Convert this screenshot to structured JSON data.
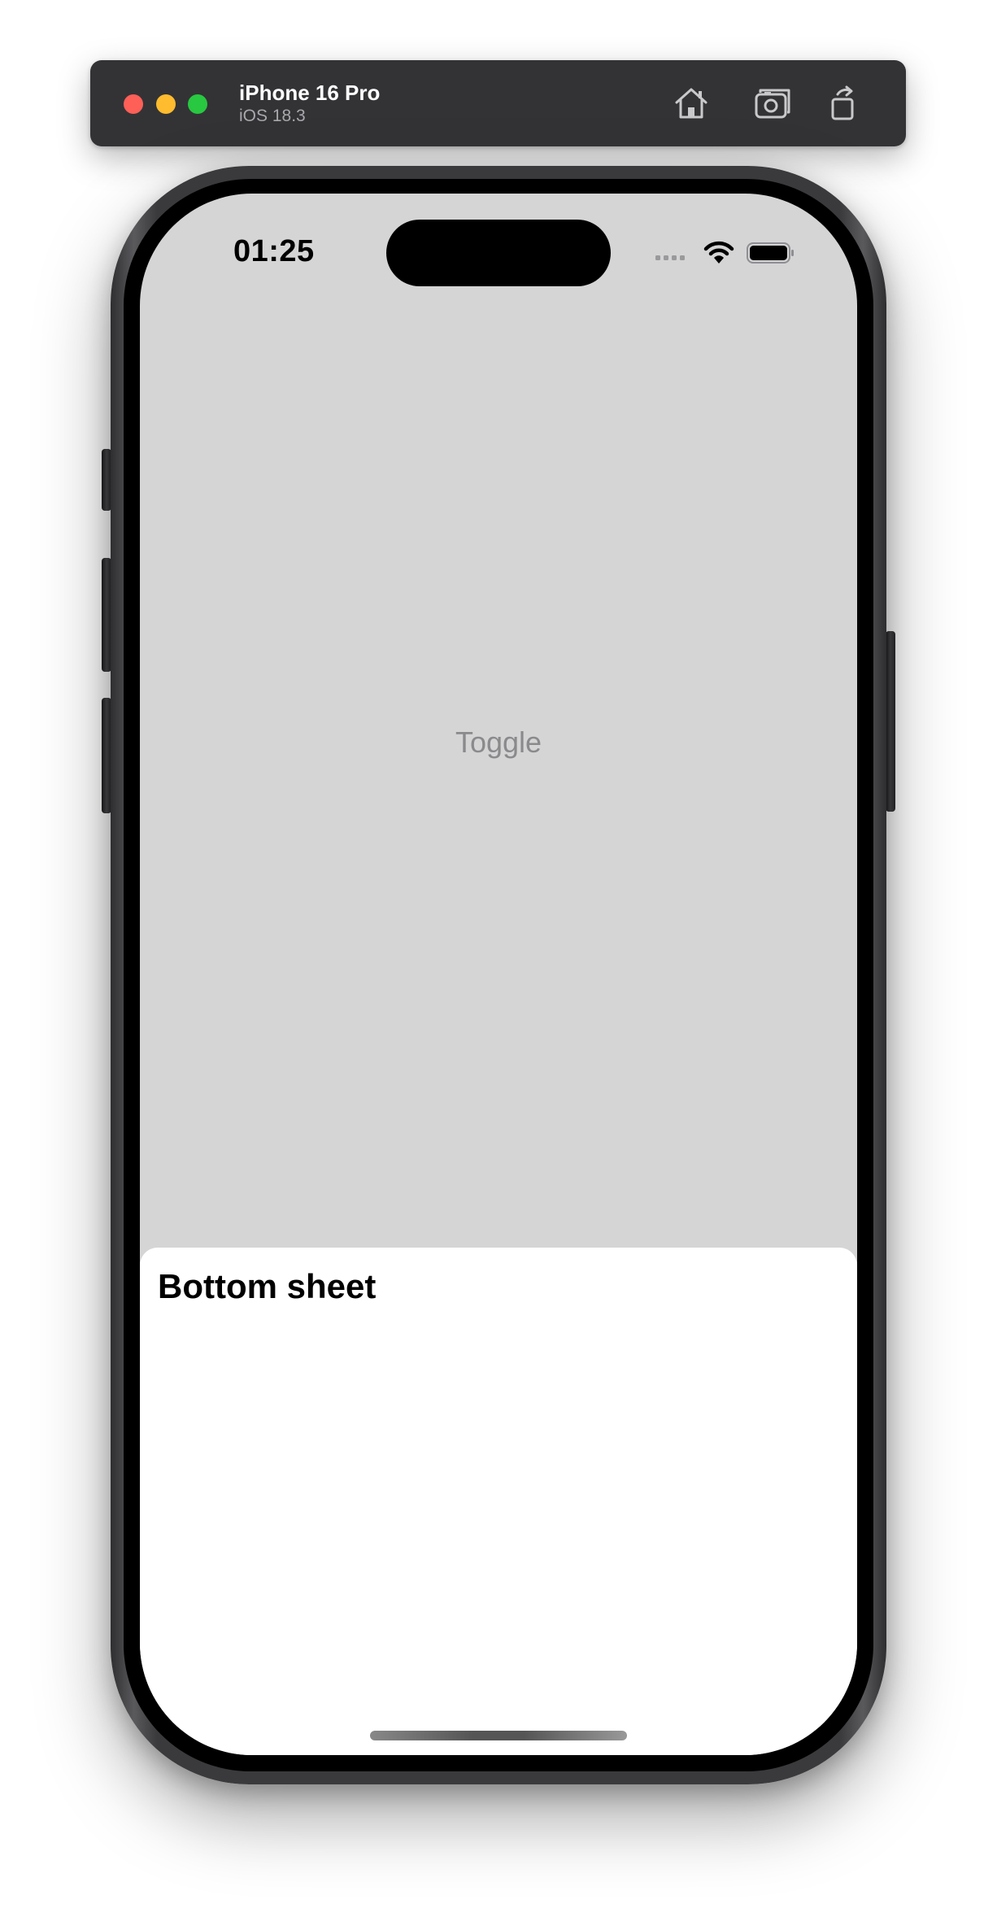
{
  "window": {
    "device_name": "iPhone 16 Pro",
    "os_version": "iOS 18.3",
    "toolbar_icons": [
      "home-icon",
      "screenshot-icon",
      "rotate-icon"
    ]
  },
  "status_bar": {
    "time": "01:25",
    "icons": [
      "cellular-signal-icon",
      "wifi-icon",
      "battery-icon"
    ]
  },
  "main": {
    "toggle_label": "Toggle"
  },
  "bottom_sheet": {
    "title": "Bottom sheet"
  },
  "colors": {
    "screen_background": "#d5d5d6",
    "sheet_background": "#ffffff",
    "toggle_text": "#8a8a8d"
  }
}
